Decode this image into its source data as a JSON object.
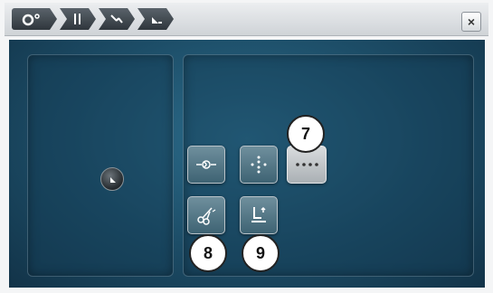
{
  "breadcrumb": {
    "items": [
      {
        "name": "presser-foot-pressure-tab",
        "icon": "foot-pressure-icon"
      },
      {
        "name": "feed-dog-tab",
        "icon": "feed-dog-icon"
      },
      {
        "name": "needle-stop-tab",
        "icon": "needle-stop-icon"
      },
      {
        "name": "foot-position-tab",
        "icon": "foot-position-icon"
      }
    ]
  },
  "close_label": "×",
  "callouts": {
    "seven": "7",
    "eight": "8",
    "nine": "9"
  },
  "colors": {
    "screen_accent": "#1c4c66",
    "button_blue": "#4e7384",
    "button_grey": "#c3c8cb"
  }
}
